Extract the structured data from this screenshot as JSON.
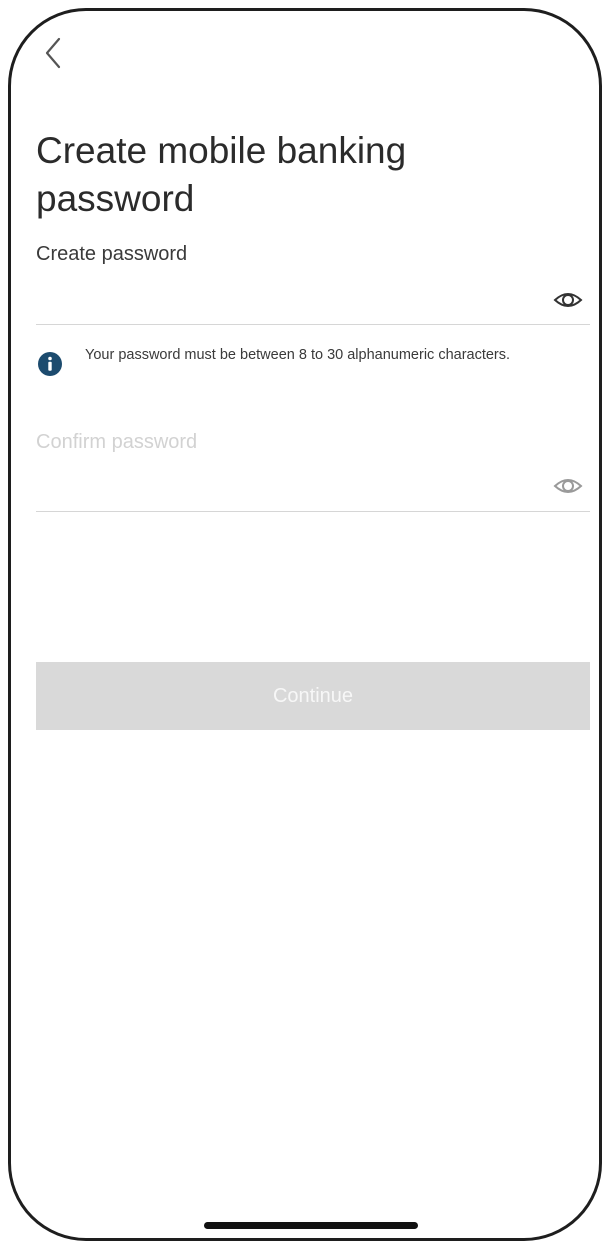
{
  "header": {
    "back_icon": "chevron-left-icon",
    "title": "Create mobile banking password"
  },
  "form": {
    "create_password": {
      "label": "Create password",
      "value": "",
      "toggle_icon": "eye-icon"
    },
    "hint": {
      "icon": "info-icon",
      "text": "Your password must be between 8 to 30 alphanumeric characters."
    },
    "confirm_password": {
      "label": "Confirm password",
      "value": "",
      "toggle_icon": "eye-icon"
    },
    "continue_label": "Continue"
  },
  "colors": {
    "info_icon": "#1c4b6e",
    "button_disabled_bg": "#d9d9d9",
    "frame": "#1e1e1e"
  }
}
